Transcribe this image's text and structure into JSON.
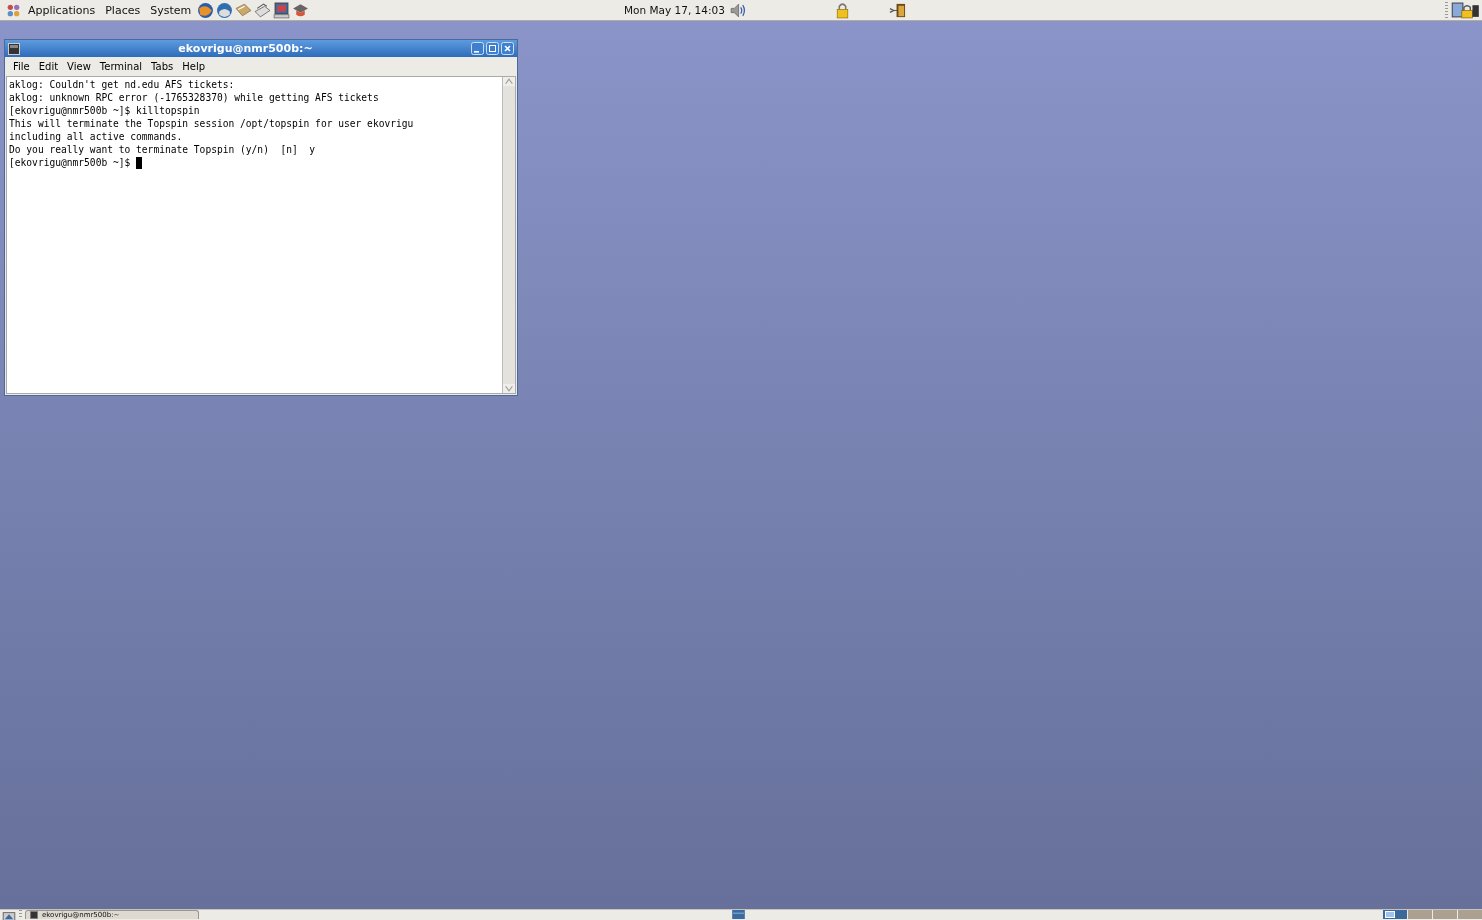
{
  "top_panel": {
    "menus": [
      "Applications",
      "Places",
      "System"
    ],
    "clock": "Mon May 17, 14:03"
  },
  "terminal_window": {
    "title": "ekovrigu@nmr500b:~",
    "menu_bar": [
      "File",
      "Edit",
      "View",
      "Terminal",
      "Tabs",
      "Help"
    ],
    "lines": [
      "aklog: Couldn't get nd.edu AFS tickets:",
      "aklog: unknown RPC error (-1765328370) while getting AFS tickets",
      "[ekovrigu@nmr500b ~]$ killtopspin",
      "This will terminate the Topspin session /opt/topspin for user ekovrigu",
      "including all active commands.",
      "Do you really want to terminate Topspin (y/n)  [n]  y",
      "[ekovrigu@nmr500b ~]$ "
    ],
    "cursor_visible": true
  },
  "bottom_panel": {
    "tasks": [
      {
        "label": "ekovrigu@nmr500b:~",
        "selected": false
      }
    ],
    "workspaces": [
      {
        "selected": true
      },
      {
        "selected": false
      },
      {
        "selected": false
      },
      {
        "selected": false
      }
    ]
  }
}
